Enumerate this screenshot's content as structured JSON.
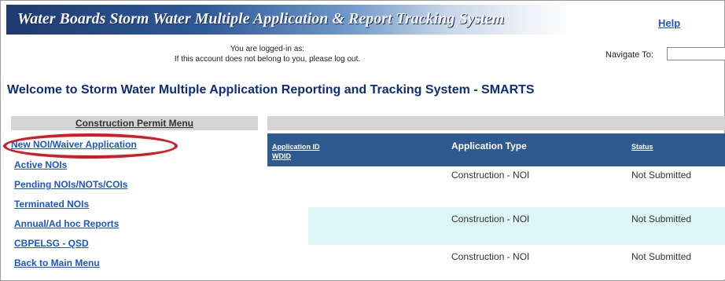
{
  "header": {
    "banner_title": "Water Boards  Storm Water Multiple Application & Report Tracking System",
    "help_link": "Help",
    "logged_in_line1": "You are logged-in as:",
    "logged_in_line2": "If this account does not belong to you, please log out.",
    "navigate_label": "Navigate To:",
    "navigate_value": ""
  },
  "welcome_title": "Welcome to Storm Water Multiple Application Reporting and Tracking System - SMARTS",
  "menu": {
    "title": "Construction Permit Menu",
    "items": [
      {
        "label": "New NOI/Waiver Application"
      },
      {
        "label": "Active NOIs"
      },
      {
        "label": "Pending NOIs/NOTs/COIs"
      },
      {
        "label": "Terminated NOIs"
      },
      {
        "label": "Annual/Ad hoc Reports"
      },
      {
        "label": "CBPELSG - QSD"
      },
      {
        "label": "Back to Main Menu"
      }
    ]
  },
  "table": {
    "headers": {
      "app_id_line1": "Application ID",
      "app_id_line2": "WDID",
      "type": "Application Type",
      "status": "Status"
    },
    "rows": [
      {
        "type": "Construction - NOI",
        "status": "Not Submitted"
      },
      {
        "type": "Construction - NOI",
        "status": "Not Submitted"
      },
      {
        "type": "Construction - NOI",
        "status": "Not Submitted"
      }
    ]
  },
  "colors": {
    "link": "#1a56c9",
    "header_blue": "#2e5a90",
    "highlight_row": "#dff6f8",
    "annotation_red": "#d11c24"
  }
}
